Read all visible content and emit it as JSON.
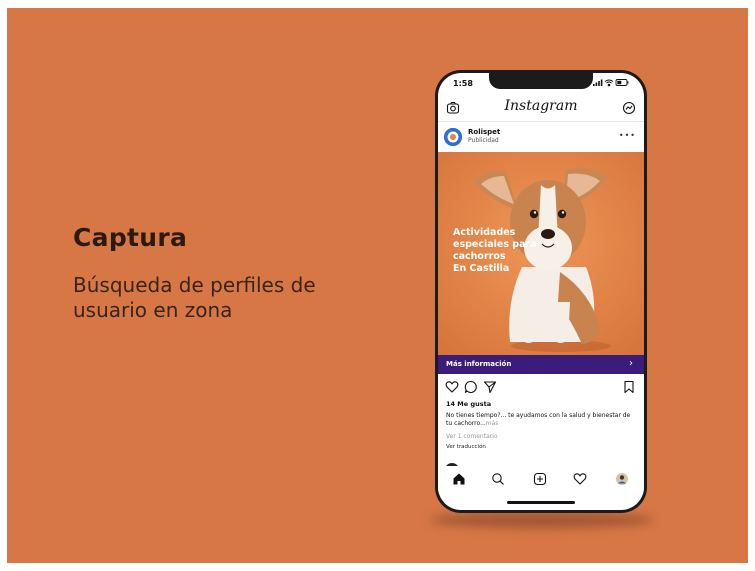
{
  "slide": {
    "background": "#d77746",
    "heading": "Captura",
    "subtitle": "Búsqueda de perfiles de usuario en zona"
  },
  "phone": {
    "status_bar": {
      "time": "1:58",
      "icons": [
        "signal-icon",
        "wifi-icon",
        "battery-icon"
      ]
    },
    "app_header": {
      "left_icon": "camera-icon",
      "logo": "Instagram",
      "right_icon": "messenger-icon"
    },
    "post": {
      "account_name": "Rolispet",
      "account_label": "Publicidad",
      "more_label": "•••",
      "image_text_lines": [
        "Actividades",
        "especiales para",
        "cachorros",
        "En Castilla"
      ],
      "cta_label": "Más información",
      "cta_chevron": "›",
      "cta_color": "#3a1c7a",
      "action_icons": [
        "heart-icon",
        "comment-icon",
        "share-icon",
        "bookmark-icon"
      ],
      "likes": "14 Me gusta",
      "caption": "No tienes tiempo?... te ayudamos con la salud y bienestar de tu cachorro...",
      "caption_more": "más",
      "comments": "Ver 1 comentario",
      "translate": "Ver traducción"
    },
    "tab_bar": [
      "home-icon",
      "search-icon",
      "add-icon",
      "activity-icon",
      "profile-icon"
    ]
  }
}
